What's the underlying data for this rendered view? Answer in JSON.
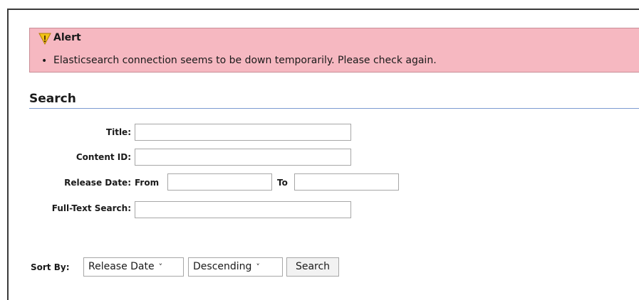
{
  "alert": {
    "title": "Alert",
    "bullet": "•",
    "message": "Elasticsearch connection seems to be down temporarily. Please check again.",
    "icon": "warning-icon",
    "bg_color": "#f6b8c1"
  },
  "search": {
    "title": "Search",
    "fields": {
      "title_label": "Title:",
      "title_value": "",
      "content_id_label": "Content ID:",
      "content_id_value": "",
      "release_date_label": "Release Date:",
      "from_label": "From",
      "from_value": "",
      "to_label": "To",
      "to_value": "",
      "fulltext_label": "Full-Text Search:",
      "fulltext_value": ""
    },
    "sort": {
      "label": "Sort By:",
      "field_selected": "Release Date",
      "order_selected": "Descending",
      "chevron": "˅",
      "button_label": "Search"
    }
  },
  "colors": {
    "rule": "#7c9ad1",
    "border": "#a7a7a7"
  }
}
